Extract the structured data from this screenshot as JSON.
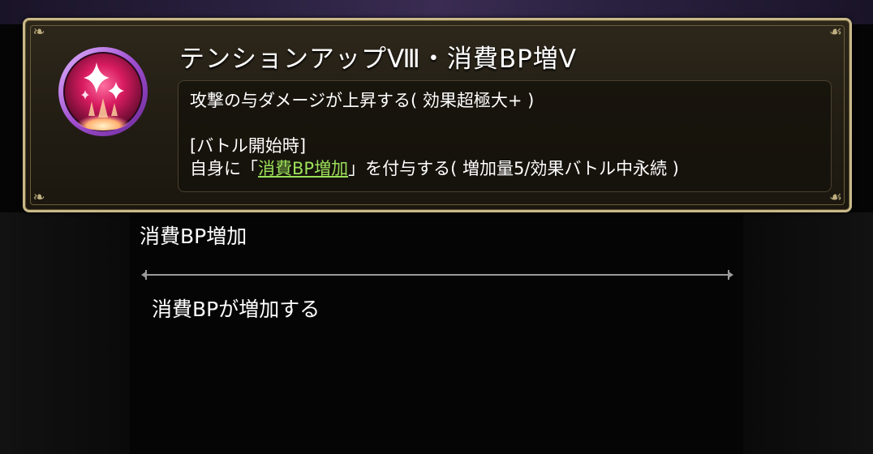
{
  "skill": {
    "icon": "sparkle-icon",
    "title": "テンションアップⅧ・消費BP増Ⅴ",
    "description": {
      "line1": "攻撃の与ダメージが上昇する( 効果超極大+ )",
      "trigger": "[バトル開始時]",
      "effect_prefix": "自身に「",
      "effect_link": "消費BP増加",
      "effect_suffix": "」を付与する( 増加量5/効果バトル中永続 )"
    }
  },
  "status_popup": {
    "name": "消費BP増加",
    "description": "消費BPが増加する"
  },
  "colors": {
    "frame_gold": "#c9b98a",
    "link_green": "#9be05a",
    "icon_magenta": "#c2185b",
    "icon_ring_purple": "#b06ad8"
  }
}
